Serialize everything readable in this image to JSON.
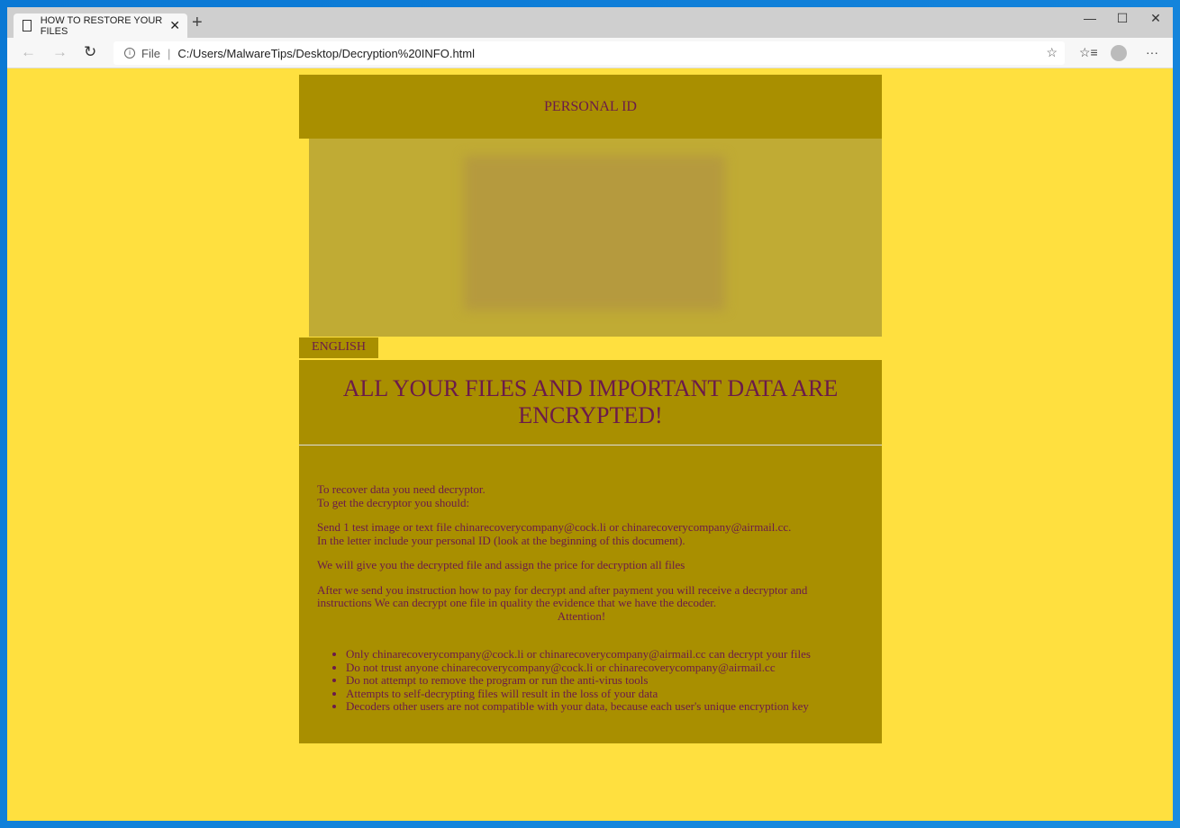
{
  "browser": {
    "tab_title": "HOW TO RESTORE YOUR FILES",
    "address_scheme": "File",
    "url": "C:/Users/MalwareTips/Desktop/Decryption%20INFO.html"
  },
  "page": {
    "personal_id_label": "PERSONAL ID",
    "language_tab": "ENGLISH",
    "headline": "ALL YOUR FILES AND IMPORTANT DATA ARE ENCRYPTED!",
    "paragraphs": [
      [
        "To recover data you need decryptor.",
        "To get the decryptor you should:"
      ],
      [
        "Send 1 test image or text file chinarecoverycompany@cock.li or chinarecoverycompany@airmail.cc.",
        "In the letter include your personal ID (look at the beginning of this document)."
      ],
      [
        "We will give you the decrypted file and assign the price for decryption all files"
      ],
      [
        "After we send you instruction how to pay for decrypt and after payment you will receive a decryptor and",
        "instructions We can decrypt one file in quality the evidence that we have the decoder."
      ]
    ],
    "attention": "Attention!",
    "bullets": [
      "Only chinarecoverycompany@cock.li or chinarecoverycompany@airmail.cc can decrypt your files",
      "Do not trust anyone chinarecoverycompany@cock.li or chinarecoverycompany@airmail.cc",
      "Do not attempt to remove the program or run the anti-virus tools",
      "Attempts to self-decrypting files will result in the loss of your data",
      "Decoders other users are not compatible with your data, because each user's unique encryption key"
    ]
  },
  "colors": {
    "page_bg": "#ffe03f",
    "panel": "#a98f00",
    "text": "#6b1a4a"
  }
}
